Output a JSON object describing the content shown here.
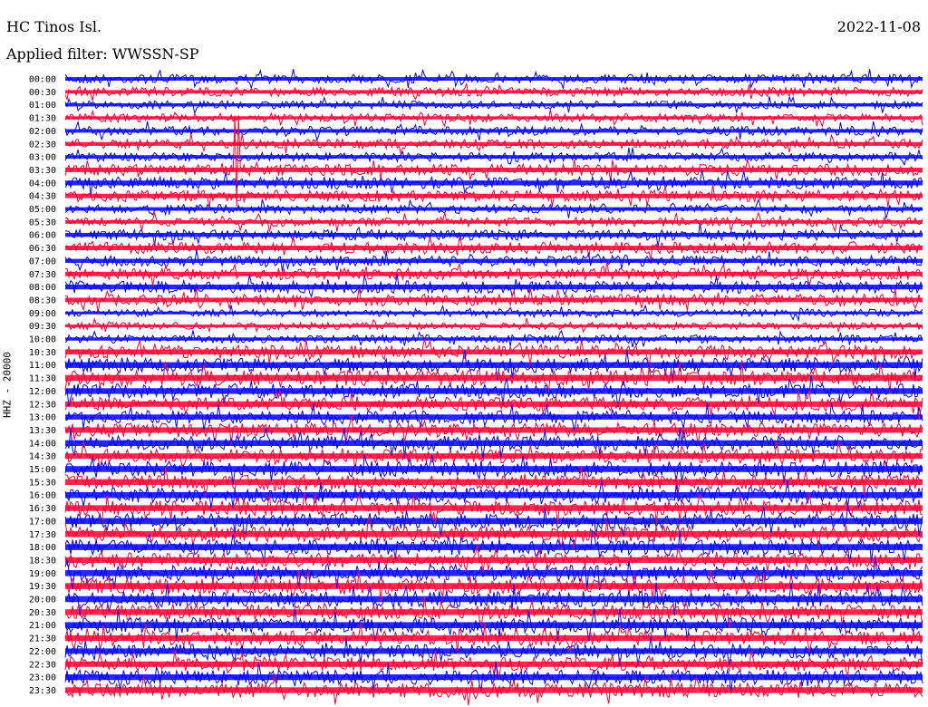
{
  "header": {
    "station": "HC Tinos Isl.",
    "date": "2022-11-08",
    "filter": "Applied filter: WWSSN-SP",
    "channel_label": "HHZ - 20000"
  },
  "colors": {
    "trace_a": "#0000ff",
    "trace_b": "#ff0033",
    "background": "#ffffff"
  },
  "chart_data": {
    "type": "line",
    "plot_kind": "helicorder",
    "row_labels": [
      "00:00",
      "00:30",
      "01:00",
      "01:30",
      "02:00",
      "02:30",
      "03:00",
      "03:30",
      "04:00",
      "04:30",
      "05:00",
      "05:30",
      "06:00",
      "06:30",
      "07:00",
      "07:30",
      "08:00",
      "08:30",
      "09:00",
      "09:30",
      "10:00",
      "10:30",
      "11:00",
      "11:30",
      "12:00",
      "12:30",
      "13:00",
      "13:30",
      "14:00",
      "14:30",
      "15:00",
      "15:30",
      "16:00",
      "16:30",
      "17:00",
      "17:30",
      "18:00",
      "18:30",
      "19:00",
      "19:30",
      "20:00",
      "20:30",
      "21:00",
      "21:30",
      "22:00",
      "22:30",
      "23:00",
      "23:30"
    ],
    "row_minutes": 30,
    "amplitude_profile": [
      0.55,
      0.55,
      0.5,
      0.5,
      0.55,
      0.6,
      0.55,
      0.7,
      0.75,
      0.7,
      0.55,
      0.55,
      0.65,
      0.7,
      0.65,
      0.7,
      0.75,
      0.7,
      0.45,
      0.45,
      0.5,
      0.8,
      0.9,
      0.95,
      0.9,
      0.85,
      0.8,
      0.85,
      0.9,
      0.85,
      0.95,
      0.9,
      0.95,
      0.9,
      0.95,
      0.95,
      0.95,
      0.9,
      0.95,
      0.95,
      0.95,
      0.9,
      0.95,
      0.9,
      0.85,
      0.85,
      0.9,
      0.9
    ],
    "events": [
      {
        "row_label": "03:30",
        "time_fraction": 0.2,
        "note": "large spike"
      }
    ]
  }
}
